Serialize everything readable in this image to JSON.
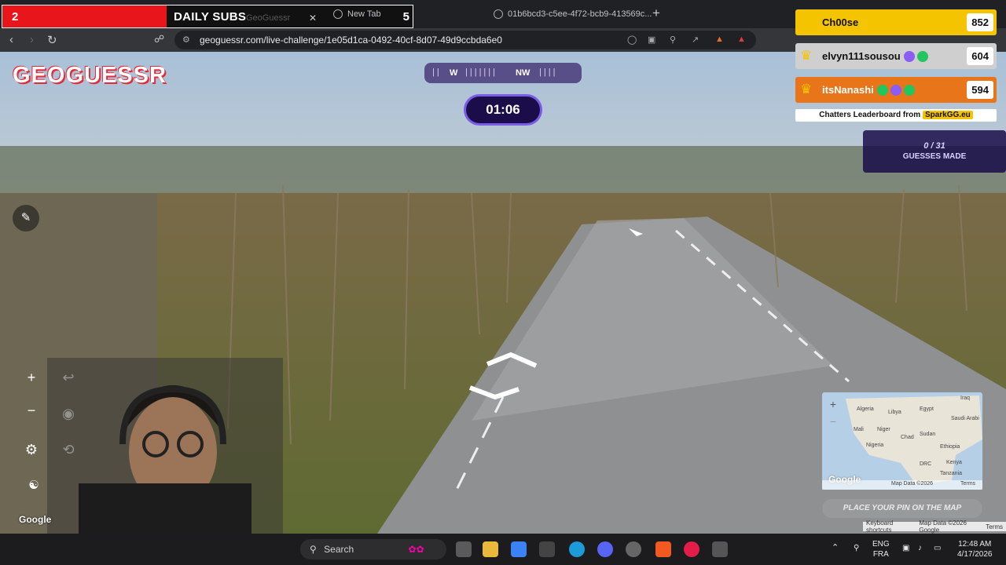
{
  "subs_bar": {
    "start": "2",
    "title": "DAILY SUBS",
    "end": "5",
    "progress": 0.4
  },
  "tabs": [
    {
      "label": "GeoGuessr"
    },
    {
      "label": "New Tab"
    },
    {
      "label": "01b6bcd3-c5ee-4f72-bcb9-413569c..."
    }
  ],
  "address": {
    "url": "geoguessr.com/live-challenge/1e05d1ca-0492-40cf-8d07-49d9ccbda6e0"
  },
  "game": {
    "logo": "GEOGUESSR",
    "compass": {
      "left": "W",
      "right": "NW"
    },
    "timer": "01:06",
    "guesses_count": "0 / 31",
    "guesses_label": "GUESSES MADE",
    "place_pin": "PLACE YOUR PIN ON THE MAP",
    "google": "Google"
  },
  "leaderboard": {
    "entries": [
      {
        "name": "Ch00se",
        "score": "852",
        "color": "#f5c400",
        "text": "#111111"
      },
      {
        "name": "elvyn111sousou",
        "score": "604",
        "color": "#cfcfcf",
        "text": "#111111"
      },
      {
        "name": "itsNanashi",
        "score": "594",
        "color": "#e8751a",
        "text": "#ffffff"
      }
    ],
    "caption": "Chatters Leaderboard from",
    "brand": "SparkGG.eu"
  },
  "minimap": {
    "labels": [
      "Algeria",
      "Libya",
      "Egypt",
      "Iraq",
      "Saudi Arabi",
      "Mali",
      "Niger",
      "Chad",
      "Sudan",
      "Nigeria",
      "Ethiopia",
      "DRC",
      "Kenya",
      "Tanzania"
    ],
    "google": "Google",
    "map_data": "Map Data ©2026",
    "terms": "Terms"
  },
  "footer": {
    "shortcuts": "Keyboard shortcuts",
    "mapdata": "Map Data ©2026 Google",
    "terms": "Terms"
  },
  "taskbar": {
    "search": "Search",
    "lang1": "ENG",
    "lang2": "FRA",
    "time": "12:48 AM",
    "date": "4/17/2026"
  }
}
